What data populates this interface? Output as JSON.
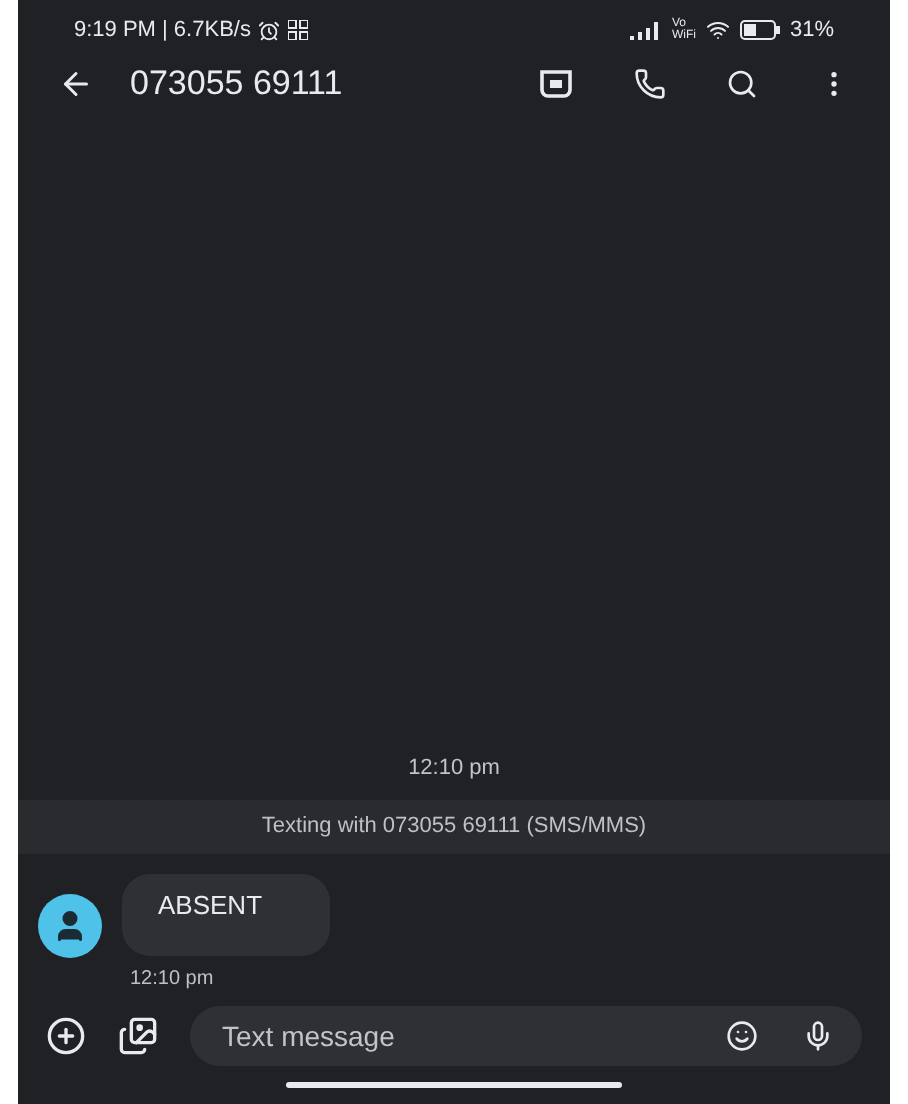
{
  "status_bar": {
    "time": "9:19 PM | 6.7KB/s",
    "network_label": [
      "Vo",
      "WiFi"
    ],
    "battery": "31%"
  },
  "app_bar": {
    "title": "073055 69111"
  },
  "conversation": {
    "timestamp": "12:10 pm",
    "banner": "Texting with 073055 69111 (SMS/MMS)",
    "messages": [
      {
        "text": "ABSENT",
        "time": "12:10 pm"
      }
    ]
  },
  "composer": {
    "placeholder": "Text message"
  }
}
